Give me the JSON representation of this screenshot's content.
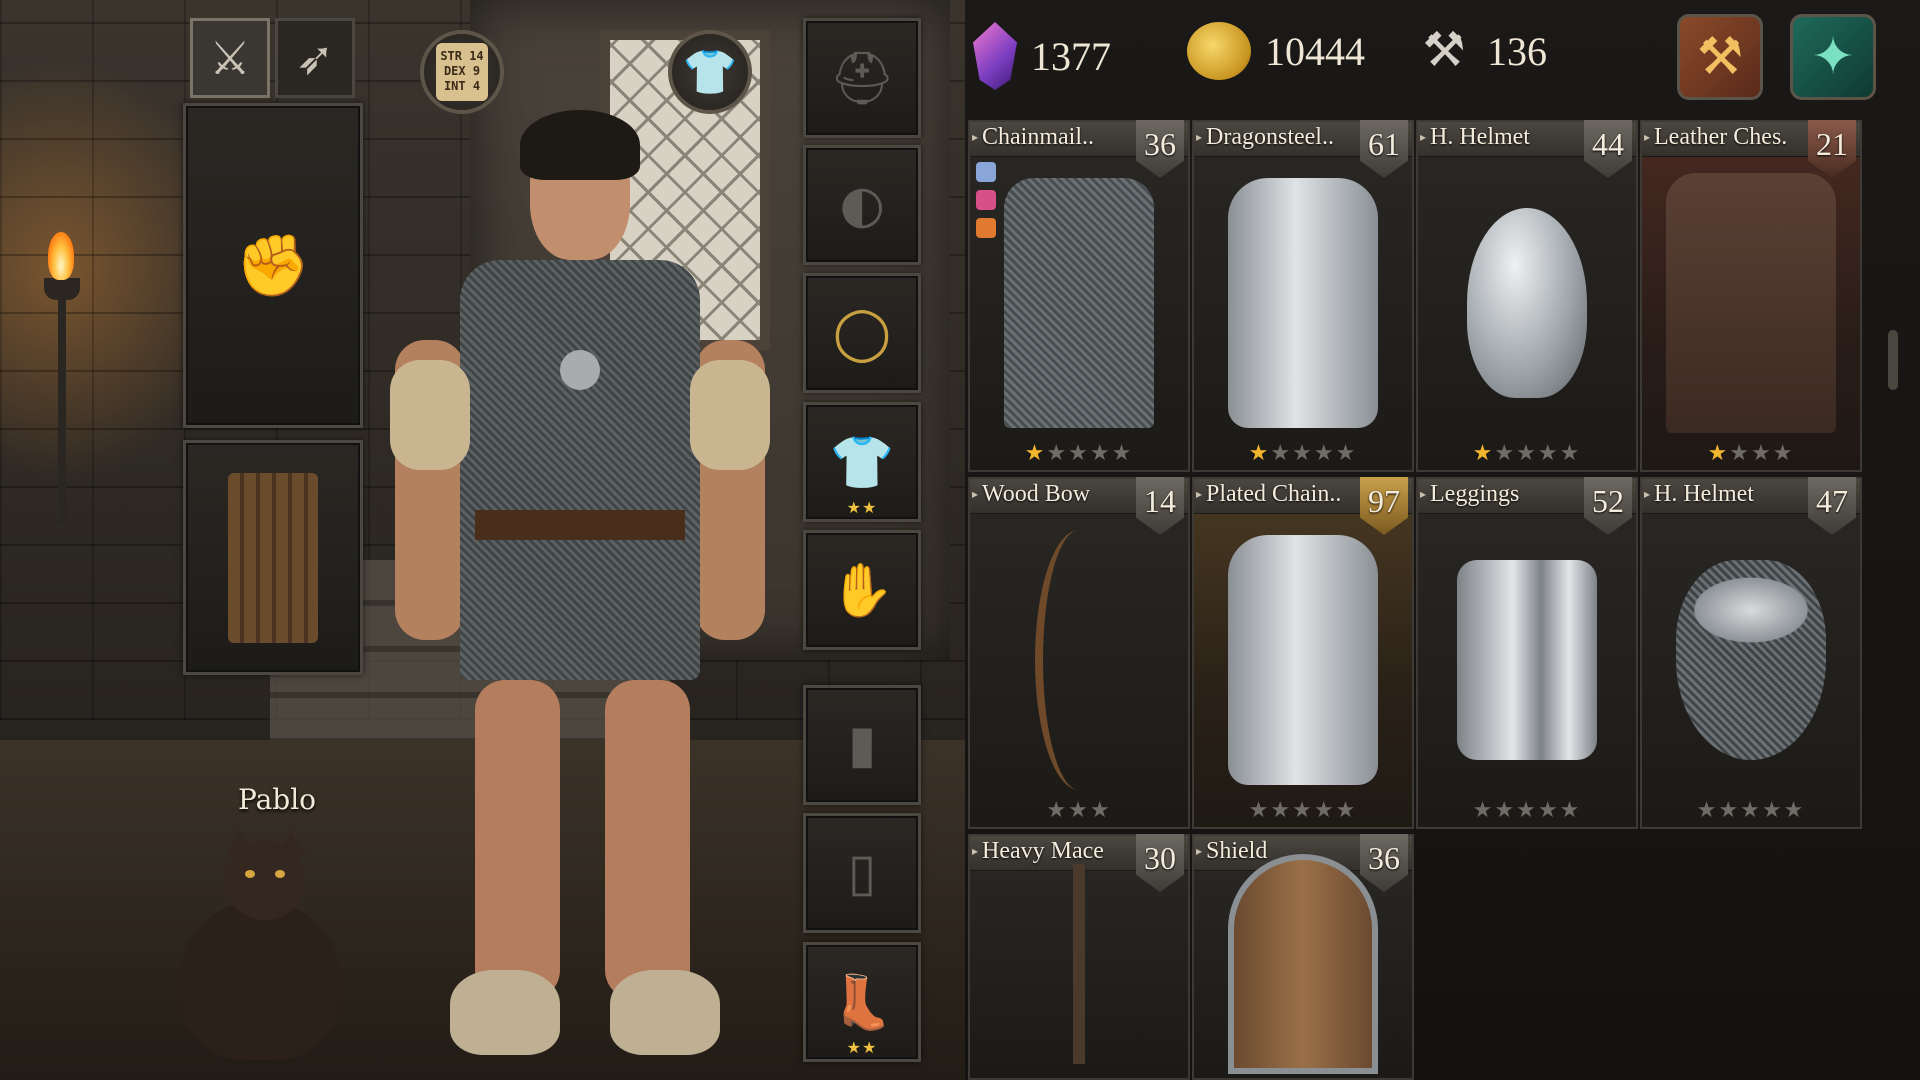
{
  "pet": {
    "name": "Pablo"
  },
  "tabs": [
    {
      "icon": "sword-icon",
      "glyph": "🗡"
    },
    {
      "icon": "bow-icon",
      "glyph": "🏹"
    }
  ],
  "stats_button": {
    "text": "STR 14\nDEX 9\nINT 4"
  },
  "currencies": {
    "gems": "1377",
    "gold": "10444",
    "materials": "136"
  },
  "equipment_slots": [
    {
      "name": "head",
      "stars": ""
    },
    {
      "name": "shoulders",
      "stars": ""
    },
    {
      "name": "neck",
      "stars": ""
    },
    {
      "name": "chest",
      "stars": "★★"
    },
    {
      "name": "gloves",
      "stars": ""
    },
    {
      "name": "arms",
      "stars": ""
    },
    {
      "name": "legs",
      "stars": ""
    },
    {
      "name": "boots",
      "stars": "★★"
    }
  ],
  "items": [
    {
      "name": "Chainmail..",
      "level": "36",
      "stars_on": 1,
      "stars_total": 5,
      "art": "chainmail",
      "theme": ""
    },
    {
      "name": "Dragonsteel..",
      "level": "61",
      "stars_on": 1,
      "stars_total": 5,
      "art": "plate",
      "theme": ""
    },
    {
      "name": "H. Helmet",
      "level": "44",
      "stars_on": 1,
      "stars_total": 5,
      "art": "helmet",
      "theme": ""
    },
    {
      "name": "Leather Ches.",
      "level": "21",
      "stars_on": 1,
      "stars_total": 4,
      "art": "leather",
      "theme": "rust"
    },
    {
      "name": "Wood Bow",
      "level": "14",
      "stars_on": 0,
      "stars_total": 3,
      "art": "bow",
      "theme": ""
    },
    {
      "name": "Plated Chain..",
      "level": "97",
      "stars_on": 0,
      "stars_total": 5,
      "art": "plate",
      "theme": "gold"
    },
    {
      "name": "Leggings",
      "level": "52",
      "stars_on": 0,
      "stars_total": 5,
      "art": "greaves",
      "theme": ""
    },
    {
      "name": "H. Helmet",
      "level": "47",
      "stars_on": 0,
      "stars_total": 5,
      "art": "kettle",
      "theme": ""
    },
    {
      "name": "Heavy Mace",
      "level": "30",
      "stars_on": 0,
      "stars_total": 0,
      "art": "mace",
      "theme": ""
    },
    {
      "name": "Shield",
      "level": "36",
      "stars_on": 0,
      "stars_total": 0,
      "art": "shield-art",
      "theme": ""
    }
  ]
}
